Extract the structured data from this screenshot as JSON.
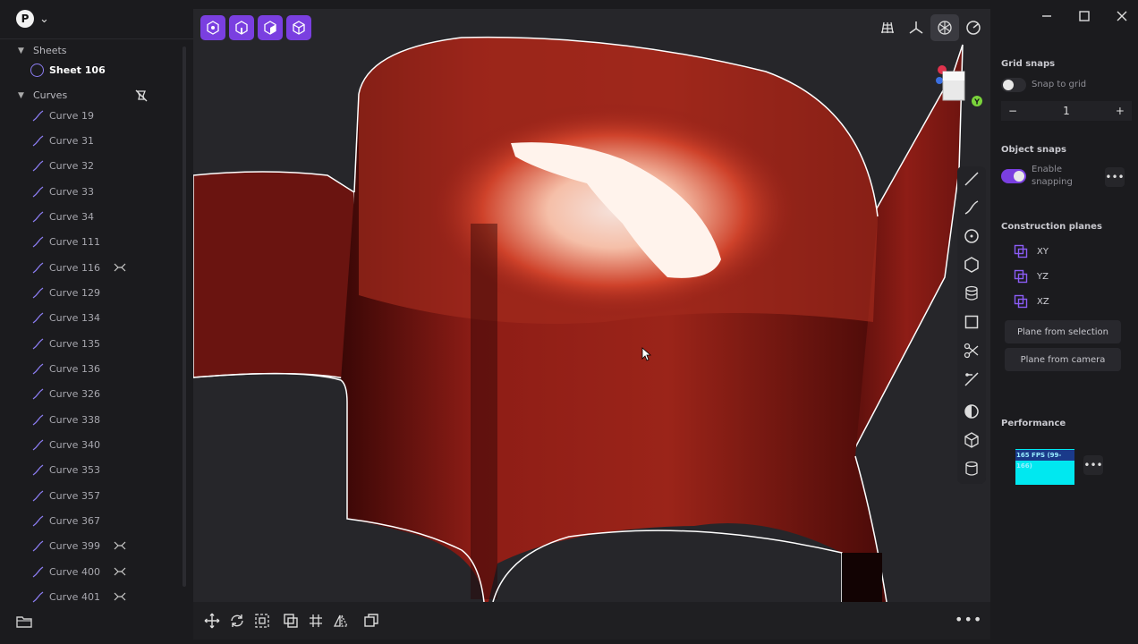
{
  "app": {
    "brand_letter": "P"
  },
  "sidebar": {
    "sheets_header": "Sheets",
    "sheet_name": "Sheet 106",
    "curves_header": "Curves",
    "curves": [
      {
        "label": "Curve 19",
        "pinned": false
      },
      {
        "label": "Curve 31",
        "pinned": false
      },
      {
        "label": "Curve 32",
        "pinned": false
      },
      {
        "label": "Curve 33",
        "pinned": false
      },
      {
        "label": "Curve 34",
        "pinned": false
      },
      {
        "label": "Curve 111",
        "pinned": false
      },
      {
        "label": "Curve 116",
        "pinned": true
      },
      {
        "label": "Curve 129",
        "pinned": false
      },
      {
        "label": "Curve 134",
        "pinned": false
      },
      {
        "label": "Curve 135",
        "pinned": false
      },
      {
        "label": "Curve 136",
        "pinned": false
      },
      {
        "label": "Curve 326",
        "pinned": false
      },
      {
        "label": "Curve 338",
        "pinned": false
      },
      {
        "label": "Curve 340",
        "pinned": false
      },
      {
        "label": "Curve 353",
        "pinned": false
      },
      {
        "label": "Curve 357",
        "pinned": false
      },
      {
        "label": "Curve 367",
        "pinned": false
      },
      {
        "label": "Curve 399",
        "pinned": true
      },
      {
        "label": "Curve 400",
        "pinned": true
      },
      {
        "label": "Curve 401",
        "pinned": true
      }
    ]
  },
  "viewport": {
    "mode_buttons": [
      "vertex-mode",
      "edge-mode",
      "face-mode",
      "object-mode"
    ],
    "view_tools": [
      "grid-icon",
      "axes-icon",
      "snowflake-icon",
      "render-sphere-icon"
    ],
    "surface_color": "#8e1d16",
    "gizmo_axis_label": "Y"
  },
  "right_panel": {
    "grid_snaps_title": "Grid snaps",
    "snap_to_grid_label": "Snap to grid",
    "snap_to_grid_on": false,
    "grid_value": "1",
    "object_snaps_title": "Object snaps",
    "enable_snapping_label": "Enable snapping",
    "enable_snapping_on": true,
    "construction_planes_title": "Construction planes",
    "planes": [
      "XY",
      "YZ",
      "XZ"
    ],
    "plane_from_selection": "Plane from selection",
    "plane_from_camera": "Plane from camera",
    "performance_title": "Performance",
    "fps_text": "165 FPS (99-166)",
    "accent_color": "#7a3fe0"
  }
}
